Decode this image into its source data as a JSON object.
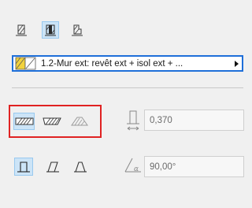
{
  "structure_type": {
    "composite_name": "1.2-Mur ext: revêt ext + isol ext + ...",
    "swatch_colors": [
      "#f2d23c",
      "#ffffff"
    ],
    "icons": [
      "wall-basic-icon",
      "wall-composite-icon",
      "wall-profile-icon"
    ],
    "selected_index": 1
  },
  "geometry_method": {
    "icons": [
      "straight-wall-icon",
      "trapezoid-wall-icon",
      "polygonal-wall-icon"
    ],
    "selected_index": 0
  },
  "thickness": {
    "icon": "wall-thickness-icon",
    "value": "0,370"
  },
  "inclination": {
    "shape_icons": [
      "wall-vertical-icon",
      "wall-slanted-icon",
      "wall-double-slanted-icon"
    ],
    "selected_index": 0,
    "angle_icon": "wall-angle-icon",
    "value": "90,00°"
  },
  "colors": {
    "selection_fill": "#cce4f7",
    "selection_border": "#99c9ef",
    "accent_blue": "#1e6fd9",
    "highlight_red": "#e02222"
  }
}
